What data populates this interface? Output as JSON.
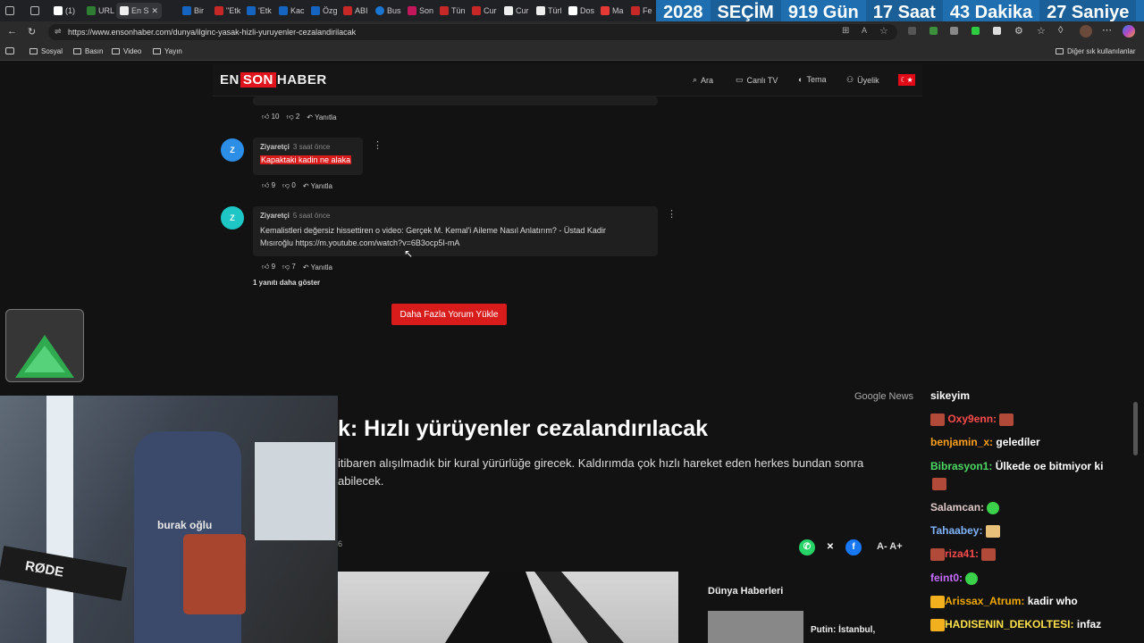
{
  "browser": {
    "tabs": [
      "(1)",
      "URL",
      "En S",
      "Bir",
      "\"Etk",
      "'Etk",
      "Kac",
      "Özg",
      "ABI",
      "Bus",
      "Son",
      "Tün",
      "Cur",
      "Cur",
      "Türl",
      "Dos",
      "Ma",
      "Fe"
    ],
    "url": "https://www.ensonhaber.com/dunya/ilginc-yasak-hizli-yuruyenler-cezalandirilacak",
    "bookmarks": [
      "Sosyal",
      "Basın",
      "Video",
      "Yayın"
    ],
    "other_bookmarks": "Diğer sık kullanılanlar"
  },
  "countdown": {
    "year": "2028",
    "label": "SEÇİM",
    "days": "919 Gün",
    "hours": "17 Saat",
    "minutes": "43 Dakika",
    "seconds": "27 Saniye"
  },
  "site": {
    "logo_en": "EN",
    "logo_son": "SON",
    "logo_haber": "HABER",
    "nav": {
      "search": "Ara",
      "live_tv": "Canlı TV",
      "theme": "Tema",
      "membership": "Üyelik"
    }
  },
  "comments": {
    "top_actions": {
      "likes": "10",
      "dislikes": "2",
      "reply": "Yanıtla"
    },
    "items": [
      {
        "avatar": "Z",
        "author": "Ziyaretçi",
        "time": "3 saat önce",
        "text": "Kapaktaki kadin ne alaka",
        "likes": "9",
        "dislikes": "0",
        "reply": "Yanıtla"
      },
      {
        "avatar": "Z",
        "author": "Ziyaretçi",
        "time": "5 saat önce",
        "text_line1": "Kemalistleri değersiz hissettiren o video: Gerçek M. Kemal'i Aileme Nasıl Anlatırım? - Üstad Kadir",
        "text_line2": "Mısıroğlu https://m.youtube.com/watch?v=6B3ocp5I-mA",
        "likes": "9",
        "dislikes": "7",
        "reply": "Yanıtla"
      }
    ],
    "more_replies": "1 yanıtı daha göster",
    "load_more": "Daha Fazla Yorum Yükle"
  },
  "article": {
    "google_news": "Google News",
    "headline": "k: Hızlı yürüyenler cezalandırılacak",
    "summary_line1": "itibaren alışılmadık bir kural yürürlüğe girecek. Kaldırımda çok hızlı hareket eden herkes bundan sonra",
    "summary_line2": "abilecek.",
    "date_fragment": "6",
    "font_controls": "A-  A+",
    "world_news_title": "Dünya Haberleri",
    "world_news_item": "Putin: İstanbul,"
  },
  "chat": [
    {
      "user": "",
      "msg": "sikeyim",
      "color": "#ffffff"
    },
    {
      "user": "Oxy9enn:",
      "msg": "",
      "color": "#ff4b4b"
    },
    {
      "user": "benjamin_x:",
      "msg": "geledíler",
      "color": "#ff9f1c"
    },
    {
      "user": "Bibrasyon1:",
      "msg": "Ülkede oe bitmiyor ki",
      "color": "#4cd964"
    },
    {
      "user": "Salamcan:",
      "msg": "",
      "color": "#e0c8c8"
    },
    {
      "user": "Tahaabey:",
      "msg": "",
      "color": "#7fb3ff"
    },
    {
      "user": "riza41:",
      "msg": "",
      "color": "#ff4b4b"
    },
    {
      "user": "feint0:",
      "msg": "",
      "color": "#c56cff"
    },
    {
      "user": "Arissax_Atrum:",
      "msg": "kadir who",
      "color": "#f2a900"
    },
    {
      "user": "HADISENIN_DEKOLTESI:",
      "msg": "infaz",
      "color": "#ffe14a"
    }
  ],
  "overlay": {
    "mic_brand": "RØDE",
    "chair_brand": "burak oğlu"
  }
}
